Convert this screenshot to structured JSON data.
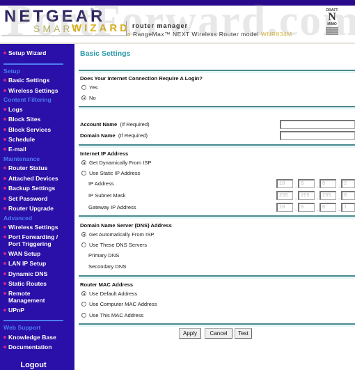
{
  "header": {
    "brand": "NETGEAR",
    "product_smart": "SMART",
    "product_wizard": "WIZARD",
    "subtitle": "router manager",
    "tagline_prefix": "RangeMax™ NEXT Wireless Router model",
    "model": "WNR834M",
    "badge_top": "DRAFT",
    "badge_letter": "N",
    "badge_bottom": "MIMO",
    "watermark": "PortForward.com"
  },
  "sidebar": {
    "setup_wizard": "Setup Wizard",
    "sections": [
      {
        "title": "Setup",
        "items": [
          "Basic Settings",
          "Wireless Settings"
        ]
      },
      {
        "title": "Content Filtering",
        "items": [
          "Logs",
          "Block Sites",
          "Block Services",
          "Schedule",
          "E-mail"
        ]
      },
      {
        "title": "Maintenance",
        "items": [
          "Router Status",
          "Attached Devices",
          "Backup Settings",
          "Set Password",
          "Router Upgrade"
        ]
      },
      {
        "title": "Advanced",
        "items": [
          "Wireless Settings",
          "Port Forwarding /",
          "Port Triggering",
          "WAN Setup",
          "LAN IP Setup",
          "Dynamic DNS",
          "Static Routes",
          "Remote",
          "Management",
          "UPnP"
        ]
      },
      {
        "title": "Web Support",
        "items": [
          "Knowledge Base",
          "Documentation"
        ]
      }
    ],
    "logout": "Logout"
  },
  "main": {
    "title": "Basic Settings",
    "login": {
      "question": "Does Your Internet Connection Require A Login?",
      "options": [
        {
          "label": "Yes",
          "checked": false
        },
        {
          "label": "No",
          "checked": true
        }
      ]
    },
    "account": {
      "account_label": "Account Name",
      "domain_label": "Domain Name",
      "if_required": "(If Required)",
      "account_value": "",
      "domain_value": ""
    },
    "internet_ip": {
      "heading": "Internet IP Address",
      "options": [
        {
          "label": "Get Dynamically From ISP",
          "checked": true
        },
        {
          "label": "Use Static IP Address",
          "checked": false
        }
      ],
      "ip_label": "IP Address",
      "subnet_label": "IP Subnet Mask",
      "gateway_label": "Gateway IP Address",
      "ip": [
        "10",
        "0",
        "0",
        "2"
      ],
      "subnet": [
        "255",
        "255",
        "255",
        "0"
      ],
      "gateway": [
        "10",
        "0",
        "0",
        "1"
      ]
    },
    "dns": {
      "heading": "Domain Name Server (DNS) Address",
      "options": [
        {
          "label": "Get Automatically From ISP",
          "checked": true
        },
        {
          "label": "Use These DNS Servers",
          "checked": false
        }
      ],
      "primary_label": "Primary DNS",
      "secondary_label": "Secondary DNS"
    },
    "mac": {
      "heading": "Router MAC Address",
      "options": [
        {
          "label": "Use Default Address",
          "checked": true
        },
        {
          "label": "Use Computer MAC Address",
          "checked": false
        },
        {
          "label": "Use This MAC Address",
          "checked": false
        }
      ]
    },
    "buttons": {
      "apply": "Apply",
      "cancel": "Cancel",
      "test": "Test"
    }
  }
}
